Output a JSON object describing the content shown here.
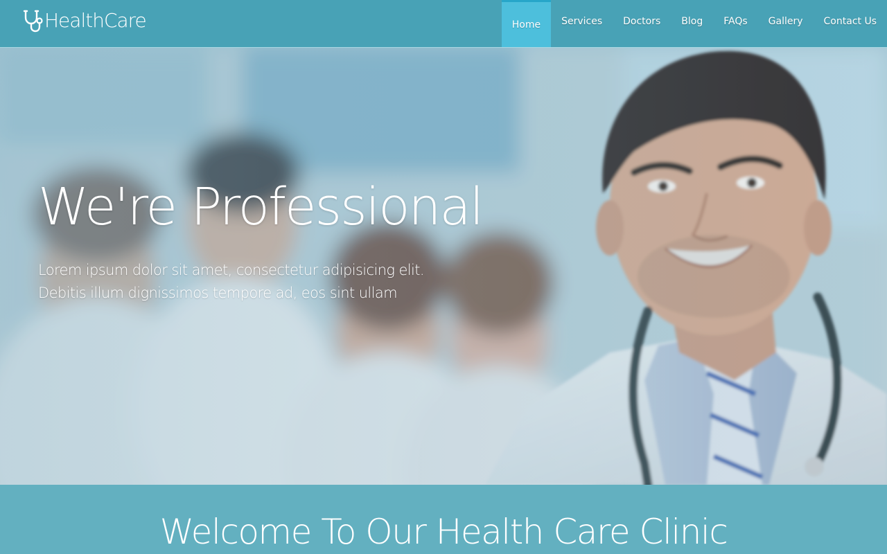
{
  "brand": {
    "name": "HealthCare",
    "icon": "stethoscope-icon"
  },
  "nav": {
    "items": [
      {
        "label": "Home",
        "active": true
      },
      {
        "label": "Services",
        "active": false
      },
      {
        "label": "Doctors",
        "active": false
      },
      {
        "label": "Blog",
        "active": false
      },
      {
        "label": "FAQs",
        "active": false
      },
      {
        "label": "Gallery",
        "active": false
      },
      {
        "label": "Contact Us",
        "active": false
      }
    ]
  },
  "hero": {
    "title": "We're Professional",
    "text": "Lorem ipsum dolor sit amet, consectetur adipisicing elit. Debitis illum dignissimos tempore ad, eos sint ullam"
  },
  "welcome": {
    "title": "Welcome To Our Health Care Clinic"
  },
  "colors": {
    "navbar": "#48a2b6",
    "nav_active": "#4dbfdc",
    "welcome_band": "#63b0c0",
    "text": "#ffffff"
  }
}
